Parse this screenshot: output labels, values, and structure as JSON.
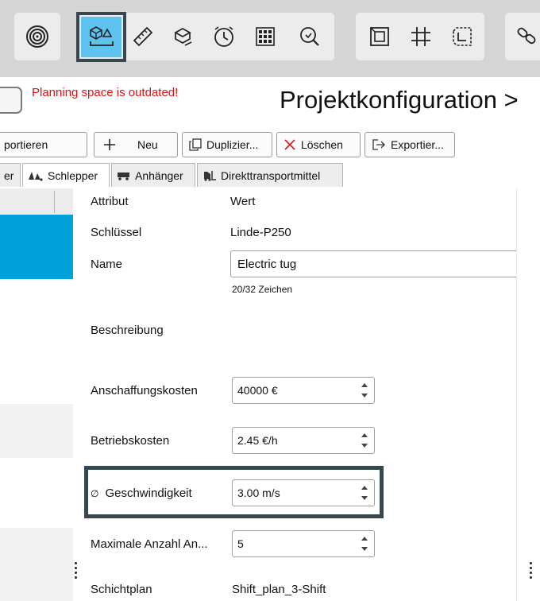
{
  "toolbar": {
    "tools": [
      "radar-icon",
      "vehicle-config-icon",
      "ruler-icon",
      "box-rotate-icon",
      "clock-icon",
      "grid-dots-icon",
      "search-refresh-icon",
      "layout-frame-icon",
      "grid-icon",
      "route-grid-icon",
      "chain-icon"
    ],
    "active_tool": "vehicle-config-icon",
    "active_color": "#5ec3ef"
  },
  "warning": {
    "text": "Planning space is outdated!",
    "color": "#e01010"
  },
  "page_title": "Projektkonfiguration >",
  "actions": {
    "import_label": "portieren",
    "new_label": "Neu",
    "duplicate_label": "Duplizier...",
    "delete_label": "Löschen",
    "export_label": "Exportier..."
  },
  "tabs": [
    {
      "label": "er"
    },
    {
      "label": "Schlepper",
      "active": true
    },
    {
      "label": "Anhänger"
    },
    {
      "label": "Direkttransportmittel"
    }
  ],
  "table": {
    "header_attribute": "Attribut",
    "header_value": "Wert",
    "rows": {
      "key": {
        "label": "Schlüssel",
        "value": "Linde-P250"
      },
      "name": {
        "label": "Name",
        "value": "Electric tug",
        "counter": "20/32 Zeichen"
      },
      "description": {
        "label": "Beschreibung"
      },
      "acquisition": {
        "label": "Anschaffungskosten",
        "value": "40000 €"
      },
      "operating": {
        "label": "Betriebskosten",
        "value": "2.45 €/h"
      },
      "speed": {
        "symbol": "∅",
        "label": "Geschwindigkeit",
        "value": "3.00 m/s"
      },
      "max_count": {
        "label": "Maximale Anzahl An...",
        "value": "5"
      },
      "shift": {
        "label": "Schichtplan",
        "value": "Shift_plan_3-Shift"
      }
    }
  },
  "colors": {
    "selection": "#00a2dc",
    "highlight_frame": "#37474f",
    "warning": "#e01010"
  }
}
